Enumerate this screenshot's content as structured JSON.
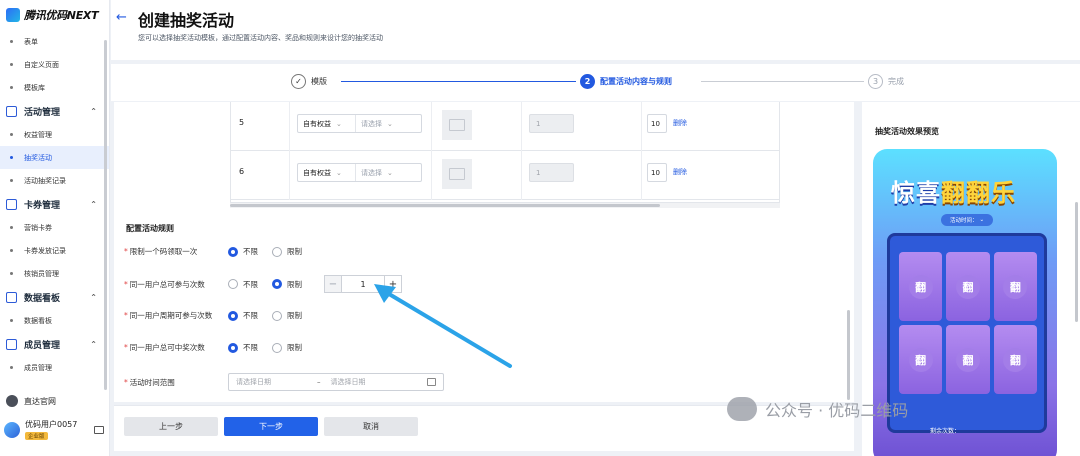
{
  "app": {
    "logo_text": "腾讯优码NEXT"
  },
  "sidebar": {
    "items": [
      {
        "type": "sub",
        "label": "表单"
      },
      {
        "type": "sub",
        "label": "自定义页面"
      },
      {
        "type": "sub",
        "label": "模板库"
      },
      {
        "type": "group",
        "label": "活动管理",
        "icon": "activity-icon"
      },
      {
        "type": "sub",
        "label": "权益管理"
      },
      {
        "type": "sub",
        "label": "抽奖活动",
        "active": true
      },
      {
        "type": "sub",
        "label": "活动抽奖记录"
      },
      {
        "type": "group",
        "label": "卡券管理",
        "icon": "coupon-icon"
      },
      {
        "type": "sub",
        "label": "营销卡券"
      },
      {
        "type": "sub",
        "label": "卡券发放记录"
      },
      {
        "type": "sub",
        "label": "核销员管理"
      },
      {
        "type": "group",
        "label": "数据看板",
        "icon": "dashboard-icon"
      },
      {
        "type": "sub",
        "label": "数据看板"
      },
      {
        "type": "group",
        "label": "成员管理",
        "icon": "member-icon"
      },
      {
        "type": "sub",
        "label": "成员管理"
      }
    ],
    "home_link": "直达官网",
    "user_name": "优码用户0057",
    "user_badge": "企业版"
  },
  "header": {
    "title": "创建抽奖活动",
    "subtitle": "您可以选择抽奖活动模板，通过配置活动内容、奖品和规则来设计您的抽奖活动"
  },
  "steps": [
    {
      "num": "✓",
      "label": "模版",
      "state": "done"
    },
    {
      "num": "2",
      "label": "配置活动内容与规则",
      "state": "current"
    },
    {
      "num": "3",
      "label": "完成",
      "state": "pending"
    }
  ],
  "prize_table": {
    "rows": [
      {
        "no": "5",
        "type": "自有权益",
        "select_placeholder": "请选择",
        "amount": "1",
        "qty": "10",
        "action": "删除"
      },
      {
        "no": "6",
        "type": "自有权益",
        "select_placeholder": "请选择",
        "amount": "1",
        "qty": "10",
        "action": "删除"
      }
    ]
  },
  "rules": {
    "section_title": "配置活动规则",
    "items": [
      {
        "label": "限制一个码领取一次",
        "opt1": "不限",
        "opt2": "限制",
        "selected": 1
      },
      {
        "label": "同一用户总可参与次数",
        "opt1": "不限",
        "opt2": "限制",
        "selected": 2,
        "stepper_value": "1"
      },
      {
        "label": "同一用户周期可参与次数",
        "opt1": "不限",
        "opt2": "限制",
        "selected": 1
      },
      {
        "label": "同一用户总可中奖次数",
        "opt1": "不限",
        "opt2": "限制",
        "selected": 1
      }
    ],
    "date_label": "活动时间范围",
    "date_start_placeholder": "请选择日期",
    "date_sep": "–",
    "date_end_placeholder": "请选择日期"
  },
  "footer": {
    "prev": "上一步",
    "next": "下一步",
    "cancel": "取消"
  },
  "preview": {
    "title": "抽奖活动效果预览",
    "game_title_a": "惊喜",
    "game_title_b": "翻翻乐",
    "time_pill": "活动时间：",
    "card_label": "翻",
    "remain": "剩余次数："
  },
  "watermark": "公众号 · 优码二维码",
  "colors": {
    "accent": "#2259e0",
    "arrow": "#2ba3e8"
  }
}
